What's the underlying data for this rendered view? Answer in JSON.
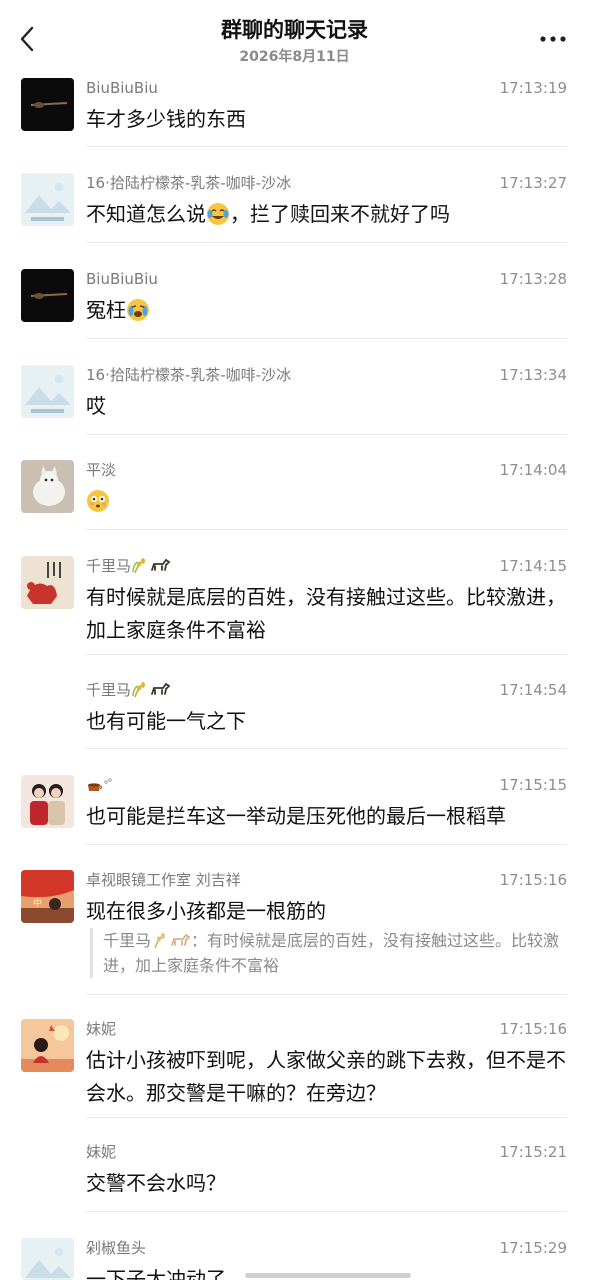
{
  "header": {
    "title": "群聊的聊天记录",
    "date": "2026年8月11日"
  },
  "messages": [
    {
      "name": "BiuBiuBiu",
      "time": "17:13:19",
      "text": "车才多少钱的东西"
    },
    {
      "name": "16·拾陆柠檬茶-乳茶-咖啡-沙冰",
      "time": "17:13:27",
      "text_a": "不知道怎么说",
      "text_b": "，拦了赎回来不就好了吗"
    },
    {
      "name": "BiuBiuBiu",
      "time": "17:13:28",
      "text": "冤枉"
    },
    {
      "name": "16·拾陆柠檬茶-乳茶-咖啡-沙冰",
      "time": "17:13:34",
      "text": "哎"
    },
    {
      "name": "平淡",
      "time": "17:14:04"
    },
    {
      "name": "千里马",
      "time": "17:14:15",
      "text": "有时候就是底层的百姓，没有接触过这些。比较激进，加上家庭条件不富裕"
    },
    {
      "name": "千里马",
      "time": "17:14:54",
      "text": "也有可能一气之下"
    },
    {
      "name": "",
      "time": "17:15:15",
      "text": "也可能是拦车这一举动是压死他的最后一根稻草"
    },
    {
      "name": "卓视眼镜工作室 刘吉祥",
      "time": "17:15:16",
      "text": "现在很多小孩都是一根筋的",
      "quote_name": "千里马",
      "quote_text": "：有时候就是底层的百姓，没有接触过这些。比较激进，加上家庭条件不富裕"
    },
    {
      "name": "妹妮",
      "time": "17:15:16",
      "text": "估计小孩被吓到呢，人家做父亲的跳下去救，但不是不会水。那交警是干嘛的？在旁边？"
    },
    {
      "name": "妹妮",
      "time": "17:15:21",
      "text": "交警不会水吗？"
    },
    {
      "name": "剁椒鱼头",
      "time": "17:15:29",
      "text": "一下子太冲动了"
    }
  ]
}
